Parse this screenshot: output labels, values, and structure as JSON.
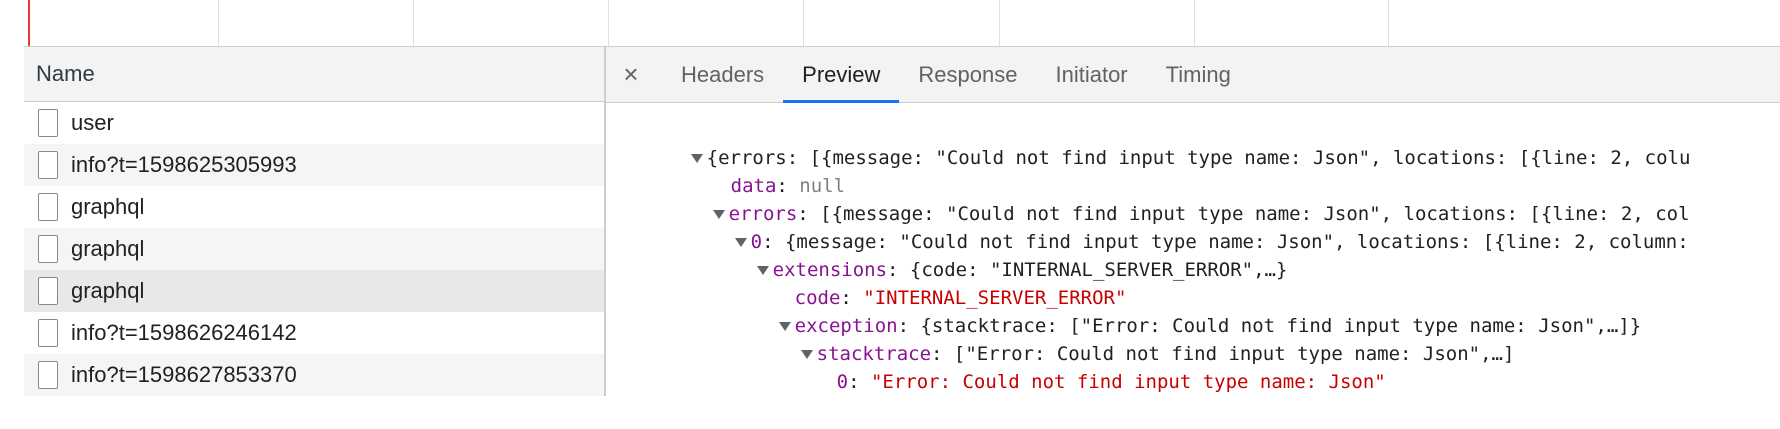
{
  "request_list": {
    "column_name": "Name",
    "rows": [
      {
        "name": "user"
      },
      {
        "name": "info?t=1598625305993"
      },
      {
        "name": "graphql"
      },
      {
        "name": "graphql"
      },
      {
        "name": "graphql"
      },
      {
        "name": "info?t=1598626246142"
      },
      {
        "name": "info?t=1598627853370"
      }
    ]
  },
  "details": {
    "close_glyph": "×",
    "tabs": [
      {
        "label": "Headers"
      },
      {
        "label": "Preview"
      },
      {
        "label": "Response"
      },
      {
        "label": "Initiator"
      },
      {
        "label": "Timing"
      }
    ],
    "active_tab": "Preview"
  },
  "preview": {
    "l1": "{errors: [{message: \"Could not find input type name: Json\", locations: [{line: 2, colu",
    "l2_key": "data",
    "l2_val": "null",
    "l3_key": "errors",
    "l3_rest": "[{message: \"Could not find input type name: Json\", locations: [{line: 2, col",
    "l4_key": "0",
    "l4_rest": "{message: \"Could not find input type name: Json\", locations: [{line: 2, column:",
    "l5_key": "extensions",
    "l5_rest": "{code: \"INTERNAL_SERVER_ERROR\",…}",
    "l6_key": "code",
    "l6_val": "\"INTERNAL_SERVER_ERROR\"",
    "l7_key": "exception",
    "l7_rest": "{stacktrace: [\"Error: Could not find input type name: Json\",…]}",
    "l8_key": "stacktrace",
    "l8_rest": "[\"Error: Could not find input type name: Json\",…]",
    "l9_key": "0",
    "l9_val": "\"Error: Could not find input type name: Json\""
  }
}
